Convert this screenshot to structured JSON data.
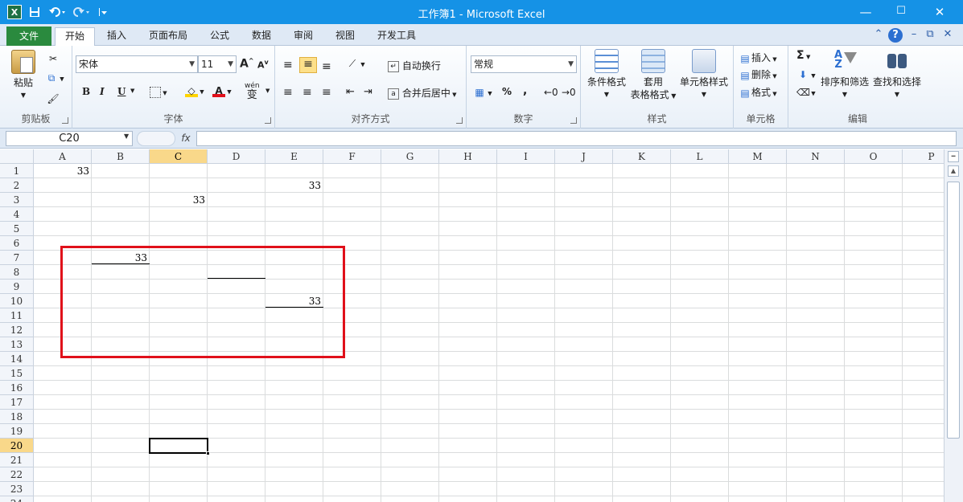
{
  "title": "工作簿1 - Microsoft Excel",
  "quick_access": {
    "excel_icon": "X",
    "save_icon": "save-icon",
    "undo_icon": "undo-icon",
    "redo_icon": "redo-icon",
    "customize_icon": "customize-icon"
  },
  "window_controls": {
    "minimize": "—",
    "maximize": "☐",
    "close": "✕"
  },
  "tabs": [
    "文件",
    "开始",
    "插入",
    "页面布局",
    "公式",
    "数据",
    "审阅",
    "视图",
    "开发工具"
  ],
  "active_tab": "开始",
  "ribbon_right": {
    "up": "⌃",
    "help": "?",
    "min": "–",
    "restore": "⧉",
    "close": "✕"
  },
  "ribbon": {
    "clipboard": {
      "paste": "粘贴",
      "cut": "✂",
      "copy": "⧉",
      "format": "🖌",
      "label": "剪贴板"
    },
    "font": {
      "name": "宋体",
      "size": "11",
      "grow": "A",
      "shrink": "A",
      "bold": "B",
      "italic": "I",
      "underline": "U",
      "phonetic": "wén",
      "phonetic_char": "变",
      "font_color_letter": "A",
      "label": "字体"
    },
    "align": {
      "wrap": "自动换行",
      "merge": "合并后居中",
      "label": "对齐方式"
    },
    "number": {
      "format": "常规",
      "percent": "%",
      "comma": ",",
      "label": "数字"
    },
    "styles": {
      "conditional": "条件格式",
      "table_1": "套用",
      "table_2": "表格格式",
      "cell_styles": "单元格样式",
      "label": "样式"
    },
    "cells": {
      "insert": "插入",
      "delete": "删除",
      "format": "格式",
      "label": "单元格"
    },
    "editing": {
      "sum": "Σ",
      "sort": "排序和筛选",
      "find": "查找和选择",
      "label": "编辑"
    }
  },
  "formula_bar": {
    "name_box": "C20",
    "fx": "fx",
    "formula": ""
  },
  "columns": [
    "A",
    "B",
    "C",
    "D",
    "E",
    "F",
    "G",
    "H",
    "I",
    "J",
    "K",
    "L",
    "M",
    "N",
    "O",
    "P"
  ],
  "rows": [
    "1",
    "2",
    "3",
    "4",
    "5",
    "6",
    "7",
    "8",
    "9",
    "10",
    "11",
    "12",
    "13",
    "14",
    "15",
    "16",
    "17",
    "18",
    "19",
    "20",
    "21",
    "22",
    "23",
    "24"
  ],
  "selected": {
    "col": "C",
    "row": "20"
  },
  "cells": [
    {
      "col": "A",
      "row": "1",
      "value": "33"
    },
    {
      "col": "E",
      "row": "2",
      "value": "33"
    },
    {
      "col": "C",
      "row": "3",
      "value": "33"
    },
    {
      "col": "B",
      "row": "7",
      "value": "33",
      "underline": true
    },
    {
      "col": "D",
      "row": "8",
      "value": "",
      "underline": true
    },
    {
      "col": "E",
      "row": "10",
      "value": "33",
      "underline": true
    }
  ],
  "annotation": {
    "color": "#e0101a"
  },
  "colors": {
    "titlebar": "#1592e6",
    "file_tab": "#2a8a3e",
    "selected_header": "#f9d88a"
  }
}
